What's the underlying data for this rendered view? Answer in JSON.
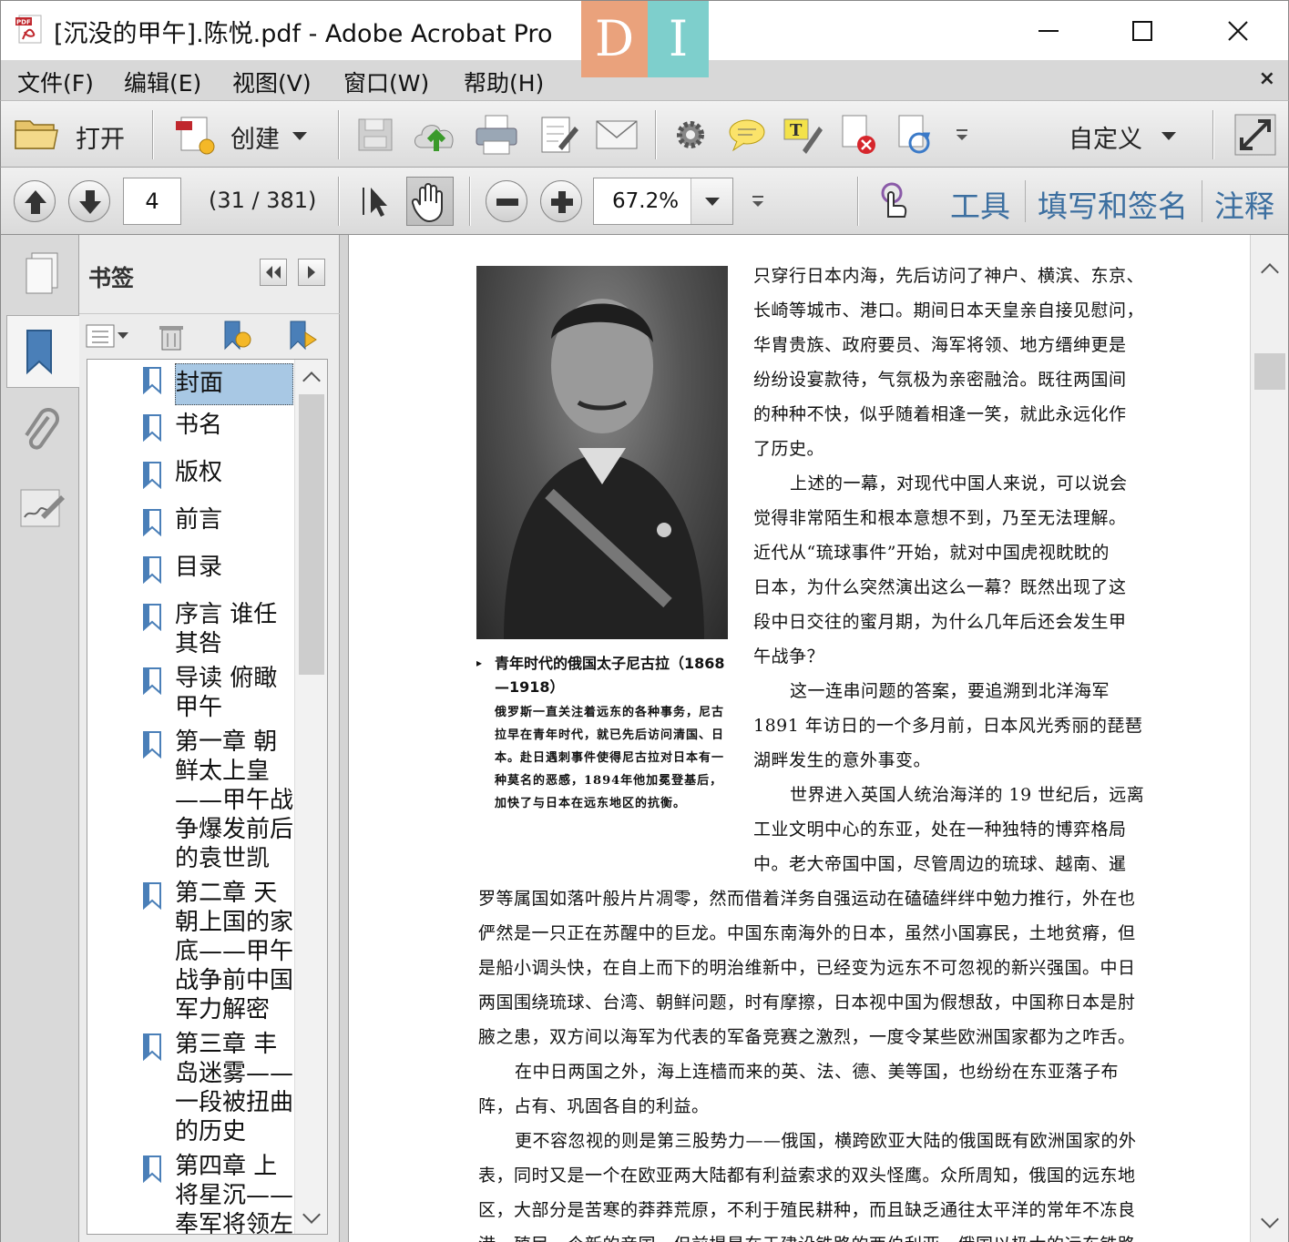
{
  "window": {
    "title": "[沉没的甲午].陈悦.pdf - Adobe Acrobat Pro",
    "watermark": {
      "left": "D",
      "right": "I"
    }
  },
  "menu": {
    "items": [
      "文件(F)",
      "编辑(E)",
      "视图(V)",
      "窗口(W)",
      "帮助(H)"
    ],
    "close": "×"
  },
  "toolbar": {
    "open_label": "打开",
    "create_label": "创建",
    "customize_label": "自定义"
  },
  "nav": {
    "current_page": "4",
    "page_count": "(31 / 381)",
    "zoom": "67.2%",
    "tools_label": "工具",
    "fill_sign_label": "填写和签名",
    "comment_label": "注释"
  },
  "bookmarks": {
    "title": "书签",
    "items": [
      "封面",
      "书名",
      "版权",
      "前言",
      "目录",
      "序言 谁任其咎",
      "导读 俯瞰甲午",
      "第一章 朝鲜太上皇——甲午战争爆发前后的袁世凯",
      "第二章 天朝上国的家底——甲午战争前中国军力解密",
      "第三章 丰岛迷雾——一段被扭曲的历史",
      "第四章 上将星沉——奉军将领左"
    ]
  },
  "document": {
    "caption_title": "青年时代的俄国太子尼古拉（1868—1918）",
    "caption_body": "俄罗斯一直关注着远东的各种事务，尼古拉早在青年时代，就已先后访问清国、日本。赴日遇刺事件使得尼古拉对日本有一种莫名的恶感，1894年他加冕登基后，加快了与日本在远东地区的抗衡。",
    "lines": [
      "只穿行日本内海，先后访问了神户、横滨、东京、",
      "长崎等城市、港口。期间日本天皇亲自接见慰问，",
      "华胄贵族、政府要员、海军将领、地方缙绅更是",
      "纷纷设宴款待，气氛极为亲密融洽。既往两国间",
      "的种种不快，似乎随着相逢一笑，就此永远化作",
      "了历史。",
      "上述的一幕，对现代中国人来说，可以说会",
      "觉得非常陌生和根本意想不到，乃至无法理解。",
      "近代从“琉球事件”开始，就对中国虎视眈眈的",
      "日本，为什么突然演出这么一幕？既然出现了这",
      "段中日交往的蜜月期，为什么几年后还会发生甲",
      "午战争？",
      "这一连串问题的答案，要追溯到北洋海军",
      "1891 年访日的一个多月前，日本风光秀丽的琵琶",
      "湖畔发生的意外事变。",
      "世界进入英国人统治海洋的 19 世纪后，远离",
      "工业文明中心的东亚，处在一种独特的博弈格局",
      "中。老大帝国中国，尽管周边的琉球、越南、暹",
      "罗等属国如落叶般片片凋零，然而借着洋务自强运动在磕磕绊绊中勉力推行，外在也",
      "俨然是一只正在苏醒中的巨龙。中国东南海外的日本，虽然小国寡民，土地贫瘠，但",
      "是船小调头快，在自上而下的明治维新中，已经变为远东不可忽视的新兴强国。中日",
      "两国围绕琉球、台湾、朝鲜问题，时有摩擦，日本视中国为假想敌，中国称日本是肘",
      "腋之患，双方间以海军为代表的军备竞赛之激烈，一度令某些欧洲国家都为之咋舌。",
      "在中日两国之外，海上连樯而来的英、法、德、美等国，也纷纷在东亚落子布",
      "阵，占有、巩固各自的利益。",
      "更不容忽视的则是第三股势力——俄国，横跨欧亚大陆的俄国既有欧洲国家的外",
      "表，同时又是一个在欧亚两大陆都有利益索求的双头怪鹰。众所周知，俄国的远东地",
      "区，大部分是苦寒的莽莽荒原，不利于殖民耕种，而且缺乏通往太平洋的常年不冻良",
      "港。殖民一个新的帝国，但前提是在于建设铁路的西伯利亚，俄国以极大的远东铁路"
    ]
  }
}
